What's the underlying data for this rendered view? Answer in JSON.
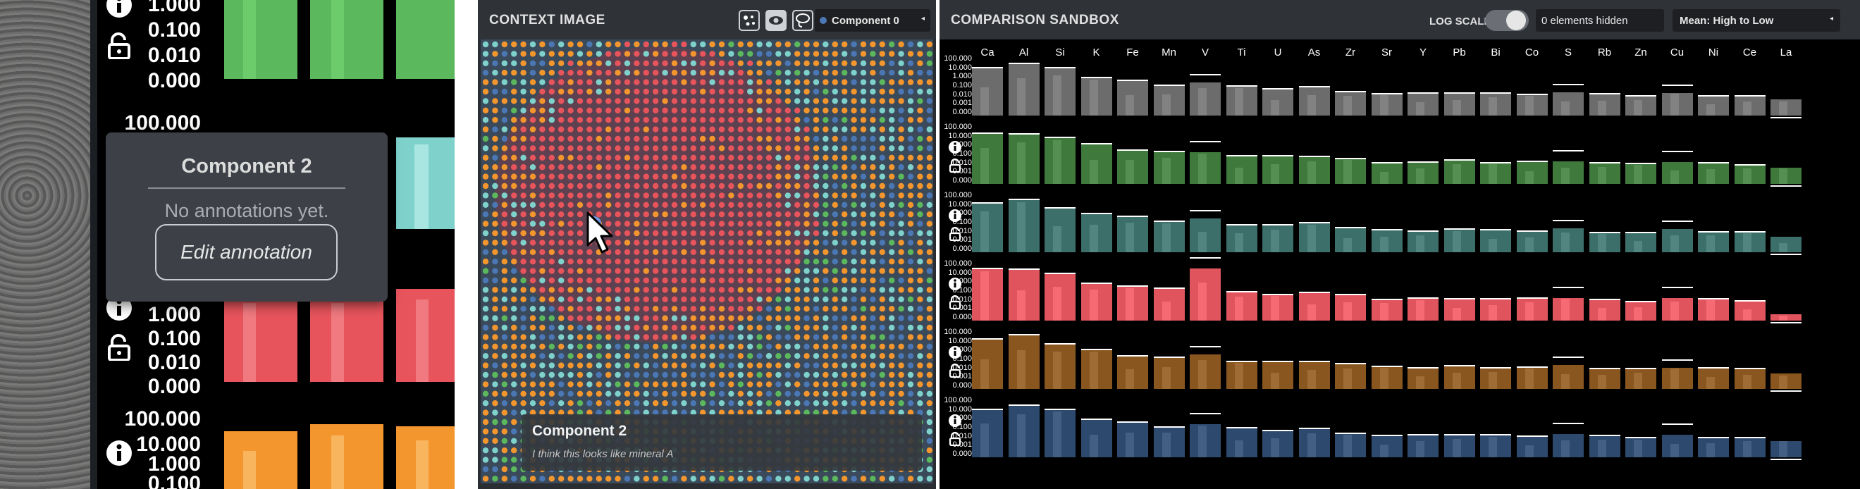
{
  "inset": {
    "tooltip": {
      "title": "Component 2",
      "message": "No annotations yet.",
      "button": "Edit annotation"
    },
    "axis_ticks": {
      "row0": [
        "1.000",
        "0.100",
        "0.010",
        "0.000"
      ],
      "row1_top": "100.000",
      "row2": [
        "1.000",
        "0.100",
        "0.010",
        "0.000"
      ],
      "row3": [
        "100.000",
        "10.000",
        "1.000",
        "0.100"
      ]
    },
    "colors": {
      "green": "#5cb85c",
      "teal": "#7fd2cc",
      "red": "#e8545c",
      "orange": "#f4962e"
    }
  },
  "context": {
    "title": "CONTEXT IMAGE",
    "selected_component": "Component 0",
    "label": {
      "title": "Component 2",
      "note": "I think this looks like mineral A"
    },
    "dot_colors": [
      "#e8545c",
      "#f4962e",
      "#4c77b5",
      "#7fd2cc",
      "#5cb85c"
    ]
  },
  "comparison": {
    "title": "COMPARISON SANDBOX",
    "log_scale_label": "LOG SCALE",
    "hidden_label": "0 elements hidden",
    "sort_label": "Mean: High to Low",
    "elements": [
      "Ca",
      "Al",
      "Si",
      "K",
      "Fe",
      "Mn",
      "V",
      "Ti",
      "U",
      "As",
      "Zr",
      "Sr",
      "Y",
      "Pb",
      "Bi",
      "Co",
      "S",
      "Rb",
      "Zn",
      "Cu",
      "Ni",
      "Ce",
      "La"
    ],
    "ticks": [
      "100.000",
      "10.000",
      "1.000",
      "0.100",
      "0.010",
      "0.001",
      "0.000"
    ],
    "rows": [
      {
        "name": "row-gray",
        "color": "#6c6c6c"
      },
      {
        "name": "row-green",
        "color": "#3f7a3c"
      },
      {
        "name": "row-teal",
        "color": "#3c6e6a"
      },
      {
        "name": "row-red",
        "color": "#e0555d"
      },
      {
        "name": "row-orange",
        "color": "#8a5620"
      },
      {
        "name": "row-blue",
        "color": "#2d4a6e"
      }
    ],
    "bar_heights": [
      0.93,
      0.97,
      0.86,
      0.72,
      0.64,
      0.58,
      0.62,
      0.52,
      0.5,
      0.52,
      0.46,
      0.4,
      0.4,
      0.42,
      0.4,
      0.4,
      0.44,
      0.38,
      0.36,
      0.42,
      0.38,
      0.36,
      0.3
    ]
  }
}
